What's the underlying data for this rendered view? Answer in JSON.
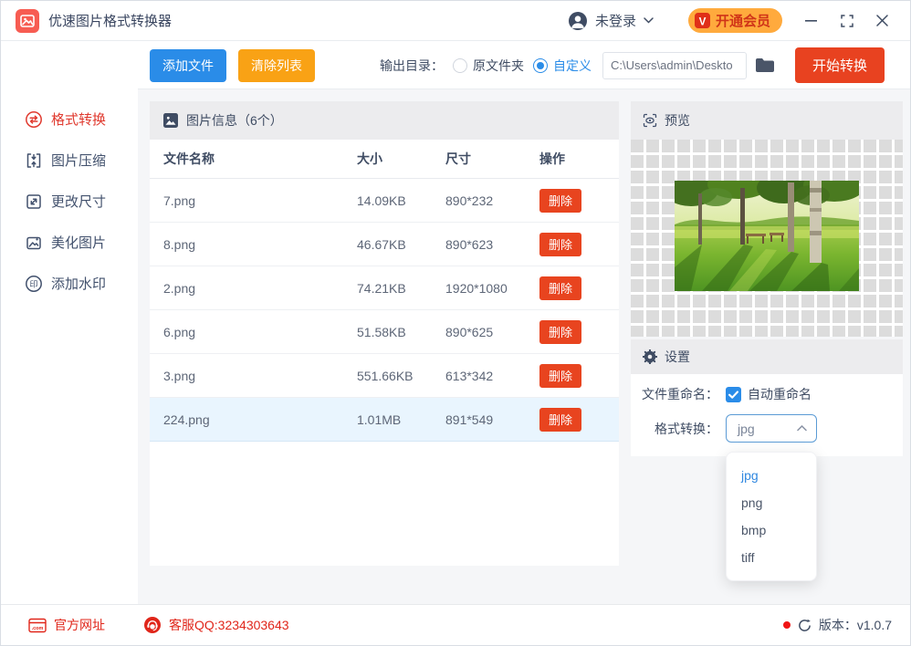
{
  "window": {
    "title": "优速图片格式转换器"
  },
  "titlebar": {
    "login_label": "未登录",
    "vip_label": "开通会员"
  },
  "sidebar": {
    "items": [
      {
        "label": "格式转换",
        "active": true
      },
      {
        "label": "图片压缩",
        "active": false
      },
      {
        "label": "更改尺寸",
        "active": false
      },
      {
        "label": "美化图片",
        "active": false
      },
      {
        "label": "添加水印",
        "active": false
      }
    ]
  },
  "toolbar": {
    "add_files": "添加文件",
    "clear_list": "清除列表",
    "output_dir_label": "输出目录：",
    "radio_original": "原文件夹",
    "radio_custom": "自定义",
    "path_value": "C:\\Users\\admin\\Deskto",
    "start": "开始转换"
  },
  "table": {
    "section_title": "图片信息（6个）",
    "columns": [
      "文件名称",
      "大小",
      "尺寸",
      "操作"
    ],
    "delete_label": "删除",
    "rows": [
      {
        "name": "7.png",
        "size": "14.09KB",
        "dims": "890*232"
      },
      {
        "name": "8.png",
        "size": "46.67KB",
        "dims": "890*623"
      },
      {
        "name": "2.png",
        "size": "74.21KB",
        "dims": "1920*1080"
      },
      {
        "name": "6.png",
        "size": "51.58KB",
        "dims": "890*625"
      },
      {
        "name": "3.png",
        "size": "551.66KB",
        "dims": "613*342"
      },
      {
        "name": "224.png",
        "size": "1.01MB",
        "dims": "891*549",
        "selected": true
      }
    ]
  },
  "preview": {
    "title": "预览"
  },
  "settings": {
    "title": "设置",
    "rename_label": "文件重命名：",
    "rename_checkbox": "自动重命名",
    "format_label": "格式转换：",
    "format_value": "jpg",
    "format_options": [
      "jpg",
      "png",
      "bmp",
      "tiff"
    ]
  },
  "footer": {
    "website": "官方网址",
    "qq": "客服QQ:3234303643",
    "version": "版本：v1.0.7"
  },
  "colors": {
    "accent_blue": "#2a8ce8",
    "accent_orange": "#f9a215",
    "accent_red": "#e84220",
    "brand_red": "#f75c52",
    "active_text": "#e03a2f",
    "selected_row": "#e9f5fe",
    "section_bar": "#ececee"
  }
}
